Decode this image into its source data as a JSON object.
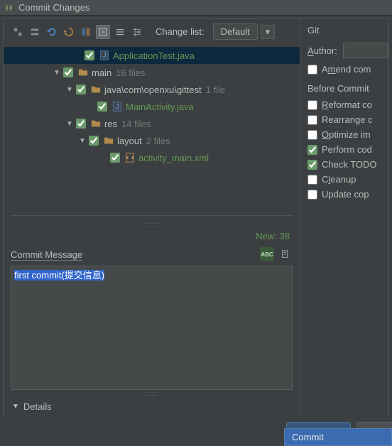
{
  "window": {
    "title": "Commit Changes"
  },
  "toolbar": {
    "change_list_label": "Change list:",
    "change_list_value": "Default"
  },
  "tree": {
    "rows": [
      {
        "indent": 90,
        "arrow": "",
        "checked": true,
        "icon": "java",
        "label": "ApplicationTest.java",
        "green": true,
        "count": "",
        "selected": true
      },
      {
        "indent": 60,
        "arrow": "▼",
        "checked": true,
        "icon": "folder",
        "label": "main",
        "green": false,
        "count": "16 files",
        "selected": false
      },
      {
        "indent": 78,
        "arrow": "▼",
        "checked": true,
        "icon": "folder",
        "label": "java\\com\\openxu\\gittest",
        "green": false,
        "count": "1 file",
        "selected": false
      },
      {
        "indent": 108,
        "arrow": "",
        "checked": true,
        "icon": "java",
        "label": "MainActivity.java",
        "green": true,
        "count": "",
        "selected": false
      },
      {
        "indent": 78,
        "arrow": "▼",
        "checked": true,
        "icon": "folder",
        "label": "res",
        "green": false,
        "count": "14 files",
        "selected": false
      },
      {
        "indent": 96,
        "arrow": "▼",
        "checked": true,
        "icon": "folder",
        "label": "layout",
        "green": false,
        "count": "2 files",
        "selected": false
      },
      {
        "indent": 126,
        "arrow": "",
        "checked": true,
        "icon": "xml",
        "label": "activity_main.xml",
        "green": true,
        "count": "",
        "selected": false
      }
    ],
    "new_count": "New: 38"
  },
  "commit_message": {
    "header": "Commit Message",
    "text": "first commit(提交信息)"
  },
  "details": {
    "label": "Details"
  },
  "vcs": {
    "title": "Git",
    "author_label": "Author:",
    "amend_label": "Amend com",
    "amend_checked": false,
    "before_commit_label": "Before Commit",
    "checks": [
      {
        "label": "Reformat co",
        "checked": false,
        "u": 0
      },
      {
        "label": "Rearrange c",
        "checked": false,
        "u": -1
      },
      {
        "label": "Optimize im",
        "checked": false,
        "u": 0
      },
      {
        "label": "Perform cod",
        "checked": true,
        "u": -1
      },
      {
        "label": "Check TODO",
        "checked": true,
        "u": -1
      },
      {
        "label": "Cleanup",
        "checked": false,
        "u": 1
      },
      {
        "label": "Update cop",
        "checked": false,
        "u": -1
      }
    ]
  },
  "buttons": {
    "commit": "Commit",
    "cancel": "Ca",
    "dropdown_item": "Commit"
  }
}
